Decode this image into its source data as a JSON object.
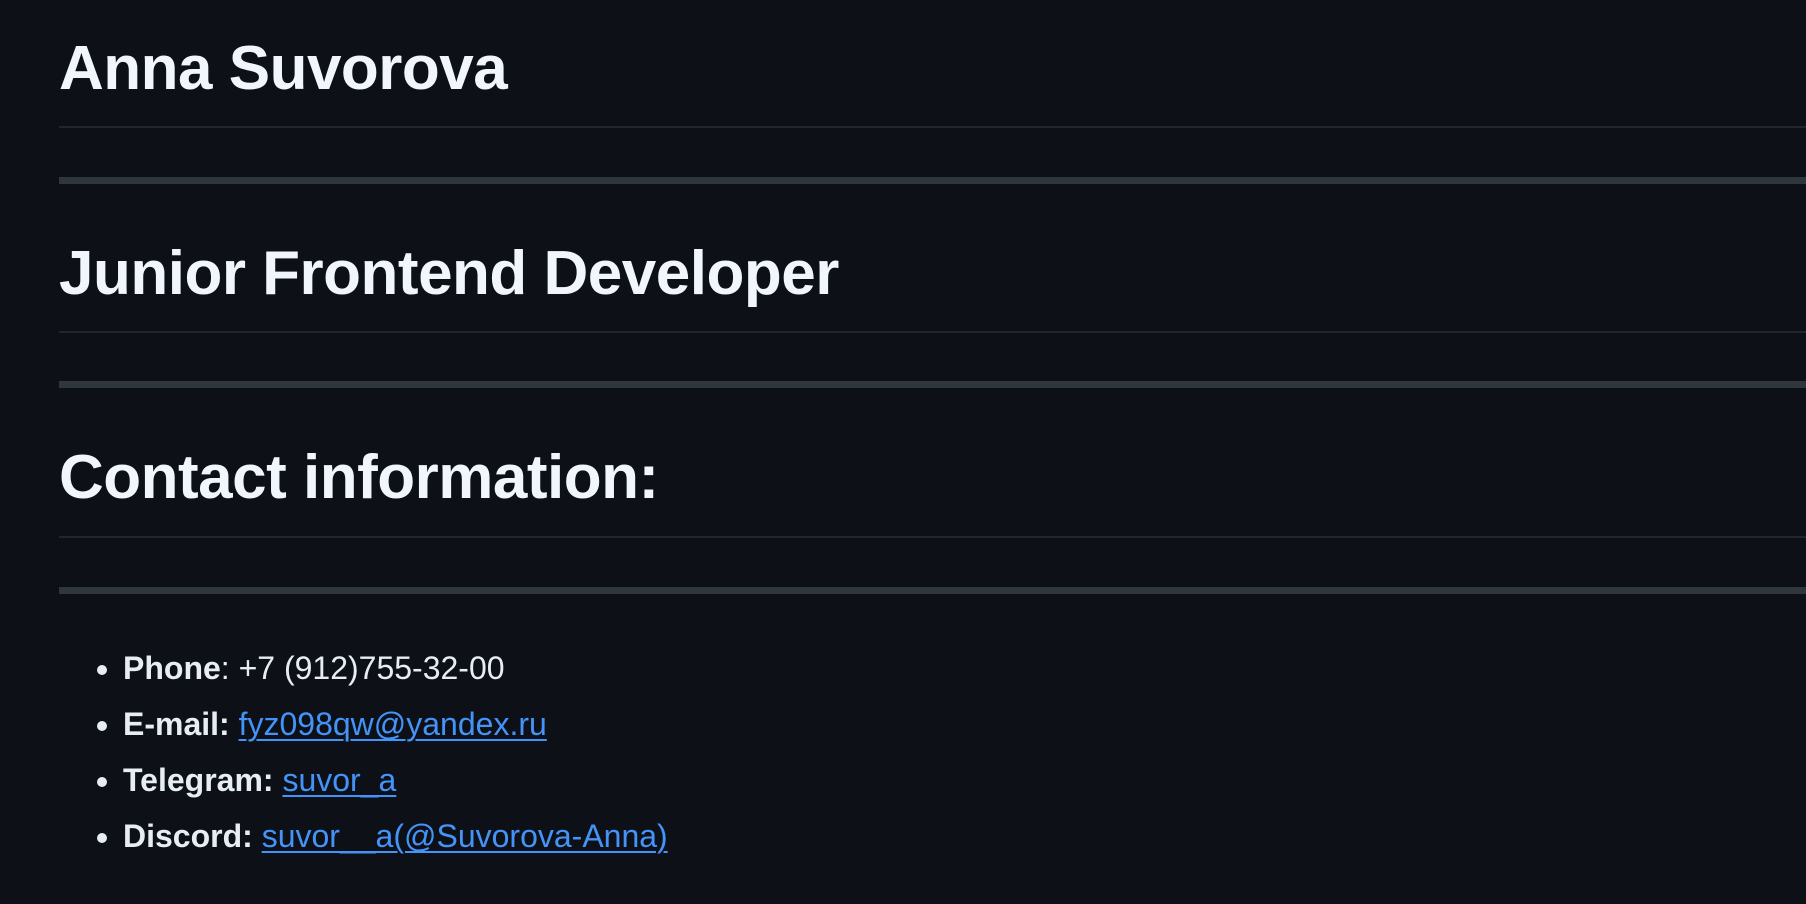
{
  "profile": {
    "name": "Anna Suvorova",
    "role": "Junior Frontend Developer",
    "contact_heading": "Contact information:"
  },
  "contacts": [
    {
      "label": "Phone",
      "separator": ": ",
      "value": "+7 (912)755-32-00",
      "is_link": false
    },
    {
      "label": "E-mail:",
      "separator": " ",
      "value": "fyz098qw@yandex.ru",
      "is_link": true
    },
    {
      "label": "Telegram:",
      "separator": " ",
      "value": "suvor_a",
      "is_link": true
    },
    {
      "label": "Discord:",
      "separator": " ",
      "value": "suvor__a(@Suvorova-Anna)",
      "is_link": true
    }
  ],
  "colors": {
    "background": "#0d1117",
    "text": "#e6edf3",
    "link": "#4493f8",
    "rule": "#30363d"
  }
}
